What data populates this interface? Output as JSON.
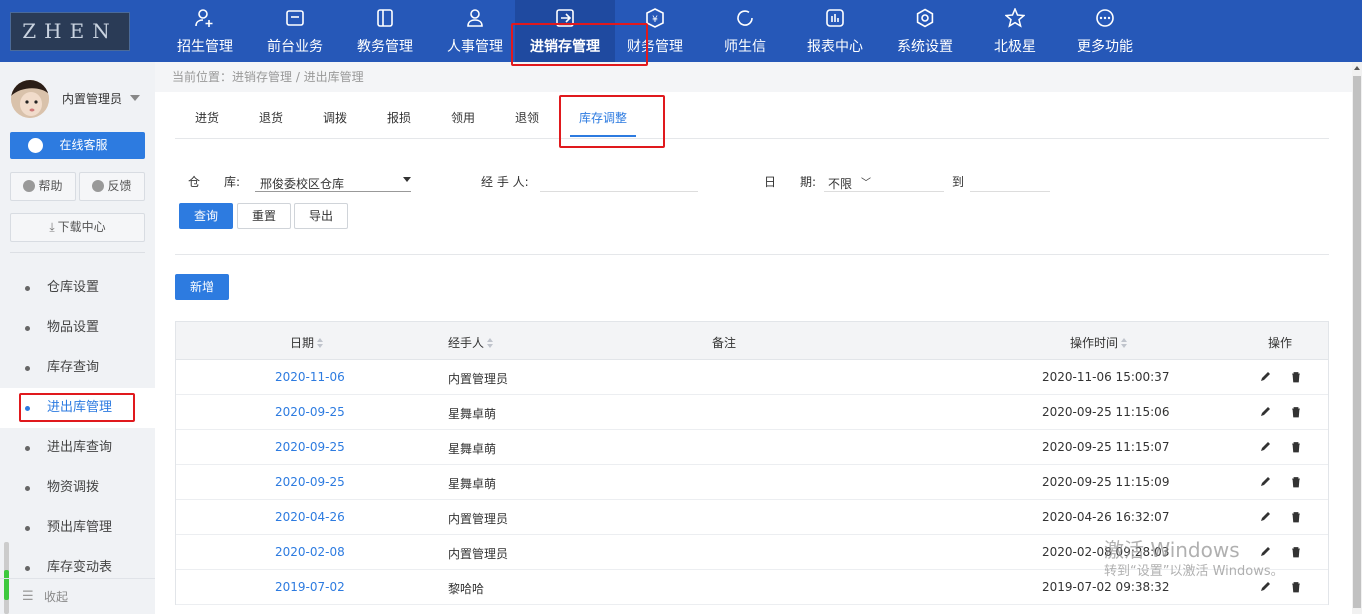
{
  "logo_text": "ZHEN",
  "top_nav": [
    {
      "label": "招生管理",
      "icon": "add-user-icon"
    },
    {
      "label": "前台业务",
      "icon": "desk-icon"
    },
    {
      "label": "教务管理",
      "icon": "book-icon"
    },
    {
      "label": "人事管理",
      "icon": "person-icon"
    },
    {
      "label": "进销存管理",
      "icon": "inventory-icon",
      "active": true
    },
    {
      "label": "财务管理",
      "icon": "finance-icon"
    },
    {
      "label": "师生信",
      "icon": "message-icon"
    },
    {
      "label": "报表中心",
      "icon": "report-icon"
    },
    {
      "label": "系统设置",
      "icon": "gear-icon"
    },
    {
      "label": "北极星",
      "icon": "star-icon"
    },
    {
      "label": "更多功能",
      "icon": "more-icon"
    }
  ],
  "user": {
    "name": "内置管理员"
  },
  "sidebar": {
    "online_service": "在线客服",
    "help": "帮助",
    "feedback": "反馈",
    "download": "下载中心",
    "items": [
      {
        "label": "仓库设置"
      },
      {
        "label": "物品设置"
      },
      {
        "label": "库存查询"
      },
      {
        "label": "进出库管理",
        "active": true
      },
      {
        "label": "进出库查询"
      },
      {
        "label": "物资调拨"
      },
      {
        "label": "预出库管理"
      },
      {
        "label": "库存变动表"
      }
    ],
    "collapse": "收起"
  },
  "breadcrumb": "当前位置：进销存管理 / 进出库管理",
  "tabs": [
    {
      "label": "进货"
    },
    {
      "label": "退货"
    },
    {
      "label": "调拨"
    },
    {
      "label": "报损"
    },
    {
      "label": "领用"
    },
    {
      "label": "退领"
    },
    {
      "label": "库存调整",
      "active": true
    }
  ],
  "filters": {
    "warehouse_label": "仓　　库:",
    "warehouse_value": "邢俊委校区仓库",
    "handler_label": "经 手 人:",
    "handler_value": "",
    "date_label": "日　　期:",
    "date_value": "不限",
    "date_to": "到",
    "date_end": ""
  },
  "buttons": {
    "query": "查询",
    "reset": "重置",
    "export": "导出",
    "add": "新增"
  },
  "table": {
    "headers": {
      "date": "日期",
      "handler": "经手人",
      "note": "备注",
      "op_time": "操作时间",
      "actions": "操作"
    },
    "rows": [
      {
        "date": "2020-11-06",
        "handler": "内置管理员",
        "note": "",
        "op_time": "2020-11-06 15:00:37"
      },
      {
        "date": "2020-09-25",
        "handler": "星舞卓萌",
        "note": "",
        "op_time": "2020-09-25 11:15:06"
      },
      {
        "date": "2020-09-25",
        "handler": "星舞卓萌",
        "note": "",
        "op_time": "2020-09-25 11:15:07"
      },
      {
        "date": "2020-09-25",
        "handler": "星舞卓萌",
        "note": "",
        "op_time": "2020-09-25 11:15:09"
      },
      {
        "date": "2020-04-26",
        "handler": "内置管理员",
        "note": "",
        "op_time": "2020-04-26 16:32:07"
      },
      {
        "date": "2020-02-08",
        "handler": "内置管理员",
        "note": "",
        "op_time": "2020-02-08 09:28:03"
      },
      {
        "date": "2019-07-02",
        "handler": "黎哈哈",
        "note": "",
        "op_time": "2019-07-02 09:38:32"
      }
    ]
  },
  "watermark": {
    "line1": "激活 Windows",
    "line2": "转到“设置”以激活 Windows。"
  },
  "colors": {
    "header_bg": "#2658b8",
    "accent": "#2d7be0",
    "highlight": "#e0191d"
  }
}
